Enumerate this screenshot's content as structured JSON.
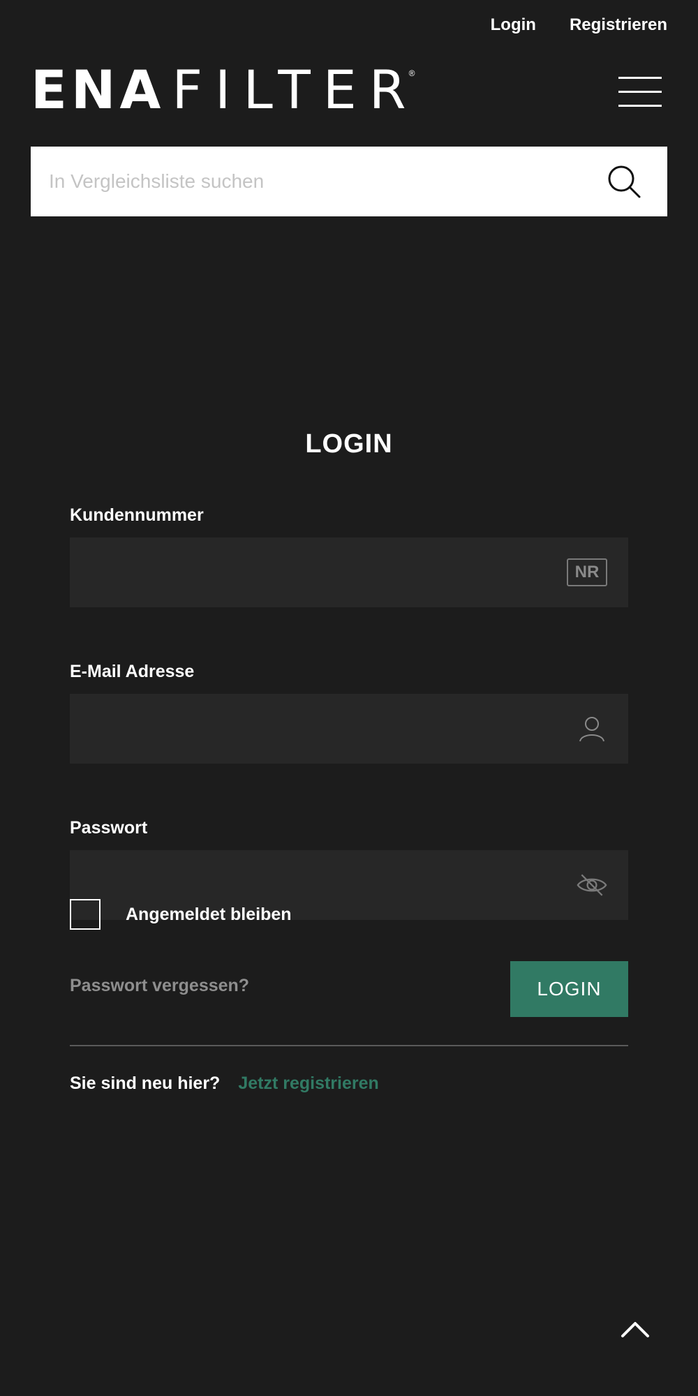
{
  "header": {
    "login_link": "Login",
    "register_link": "Registrieren",
    "logo": {
      "part_bold": "ENA",
      "part_light": "FILTER",
      "registered": "®"
    },
    "menu_icon": "hamburger-icon"
  },
  "search": {
    "placeholder": "In Vergleichsliste suchen",
    "value": "",
    "icon": "search-icon"
  },
  "login": {
    "title": "LOGIN",
    "customer_number": {
      "label": "Kundennummer",
      "value": "",
      "icon_text": "NR"
    },
    "email": {
      "label": "E-Mail Adresse",
      "value": "",
      "icon": "user-icon"
    },
    "password": {
      "label": "Passwort",
      "value": "",
      "icon": "eye-slash-icon"
    },
    "remember_me": {
      "label": "Angemeldet bleiben",
      "checked": false
    },
    "forgot_password": "Passwort vergessen?",
    "submit_label": "LOGIN",
    "new_here_text": "Sie sind neu hier?",
    "register_now": "Jetzt registrieren"
  },
  "scroll_top_icon": "chevron-up-icon",
  "colors": {
    "background": "#1c1c1c",
    "field_background": "#272727",
    "accent": "#317a64",
    "muted_text": "#8e8e8e"
  }
}
